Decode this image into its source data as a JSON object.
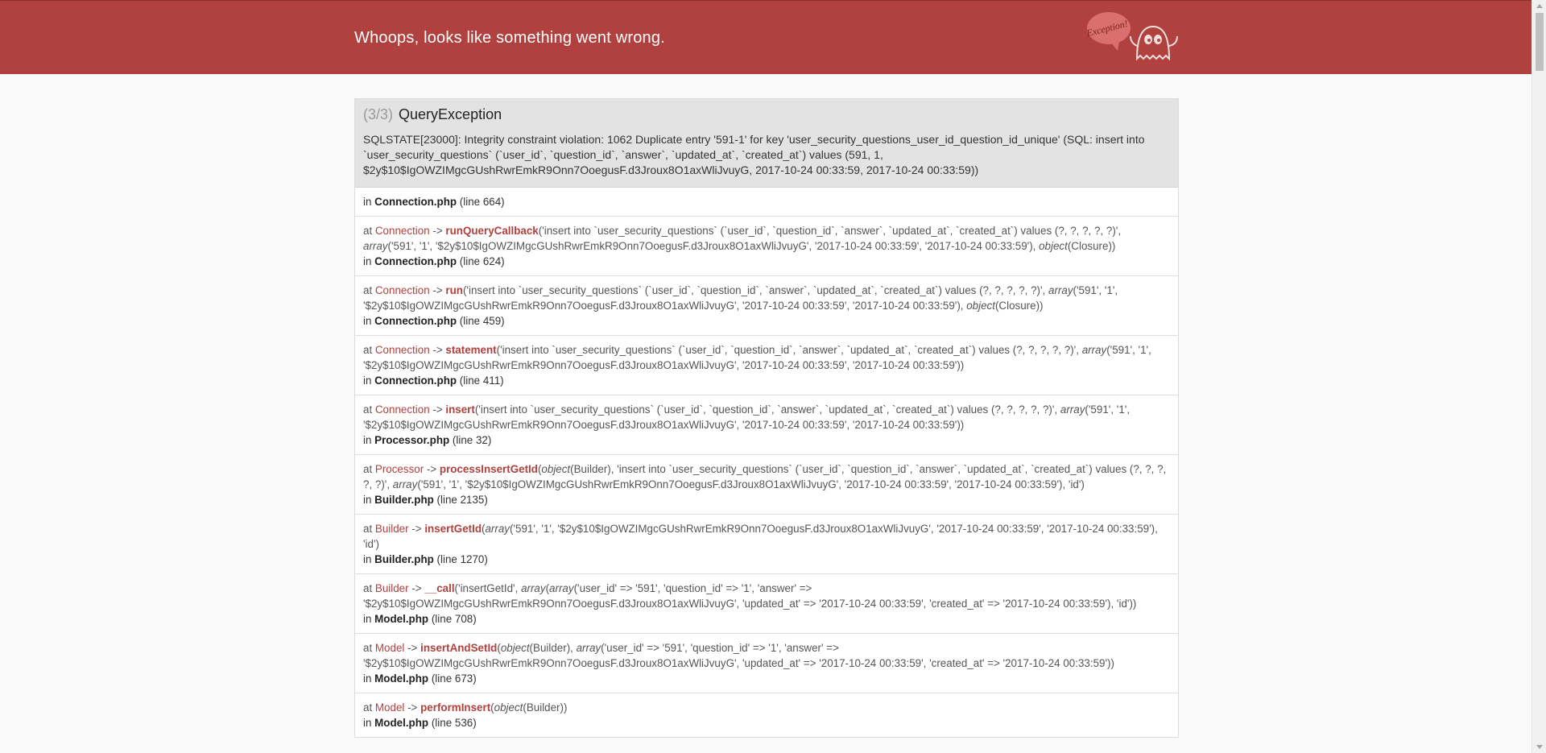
{
  "header": {
    "title": "Whoops, looks like something went wrong.",
    "logo_text": "Exception!",
    "logo_icon": "ghost-icon",
    "bg_color": "#b0413e"
  },
  "exception": {
    "count": "(3/3)",
    "name": "QueryException",
    "message": "SQLSTATE[23000]: Integrity constraint violation: 1062 Duplicate entry '591-1' for key 'user_security_questions_user_id_question_id_unique' (SQL: insert into `user_security_questions` (`user_id`, `question_id`, `answer`, `updated_at`, `created_at`) values (591, 1, $2y$10$IgOWZIMgcGUshRwrEmkR9Onn7OoegusF.d3Jroux8O1axWliJvuyG, 2017-10-24 00:33:59, 2017-10-24 00:33:59))"
  },
  "trace": [
    {
      "in_prefix": "in ",
      "file": "Connection.php",
      "line": "(line 664)"
    },
    {
      "at": "at ",
      "class": "Connection",
      "arrow": " -> ",
      "method": "runQueryCallback",
      "args_html": "('insert into `user_security_questions` (`user_id`, `question_id`, `answer`, `updated_at`, `created_at`) values (?, ?, ?, ?, ?)', <i>array</i>('591', '1', '$2y$10$IgOWZIMgcGUshRwrEmkR9Onn7OoegusF.d3Jroux8O1axWliJvuyG', '2017-10-24 00:33:59', '2017-10-24 00:33:59'), <i>object</i>(Closure))",
      "in_prefix": "in ",
      "file": "Connection.php",
      "line": "(line 624)"
    },
    {
      "at": "at ",
      "class": "Connection",
      "arrow": " -> ",
      "method": "run",
      "args_html": "('insert into `user_security_questions` (`user_id`, `question_id`, `answer`, `updated_at`, `created_at`) values (?, ?, ?, ?, ?)', <i>array</i>('591', '1', '$2y$10$IgOWZIMgcGUshRwrEmkR9Onn7OoegusF.d3Jroux8O1axWliJvuyG', '2017-10-24 00:33:59', '2017-10-24 00:33:59'), <i>object</i>(Closure))",
      "in_prefix": "in ",
      "file": "Connection.php",
      "line": "(line 459)"
    },
    {
      "at": "at ",
      "class": "Connection",
      "arrow": " -> ",
      "method": "statement",
      "args_html": "('insert into `user_security_questions` (`user_id`, `question_id`, `answer`, `updated_at`, `created_at`) values (?, ?, ?, ?, ?)', <i>array</i>('591', '1', '$2y$10$IgOWZIMgcGUshRwrEmkR9Onn7OoegusF.d3Jroux8O1axWliJvuyG', '2017-10-24 00:33:59', '2017-10-24 00:33:59'))",
      "in_prefix": "in ",
      "file": "Connection.php",
      "line": "(line 411)"
    },
    {
      "at": "at ",
      "class": "Connection",
      "arrow": " -> ",
      "method": "insert",
      "args_html": "('insert into `user_security_questions` (`user_id`, `question_id`, `answer`, `updated_at`, `created_at`) values (?, ?, ?, ?, ?)', <i>array</i>('591', '1', '$2y$10$IgOWZIMgcGUshRwrEmkR9Onn7OoegusF.d3Jroux8O1axWliJvuyG', '2017-10-24 00:33:59', '2017-10-24 00:33:59'))",
      "in_prefix": "in ",
      "file": "Processor.php",
      "line": "(line 32)"
    },
    {
      "at": "at ",
      "class": "Processor",
      "arrow": " -> ",
      "method": "processInsertGetId",
      "args_html": "(<i>object</i>(Builder), 'insert into `user_security_questions` (`user_id`, `question_id`, `answer`, `updated_at`, `created_at`) values (?, ?, ?, ?, ?)', <i>array</i>('591', '1', '$2y$10$IgOWZIMgcGUshRwrEmkR9Onn7OoegusF.d3Jroux8O1axWliJvuyG', '2017-10-24 00:33:59', '2017-10-24 00:33:59'), 'id')",
      "in_prefix": "in ",
      "file": "Builder.php",
      "line": "(line 2135)"
    },
    {
      "at": "at ",
      "class": "Builder",
      "arrow": " -> ",
      "method": "insertGetId",
      "args_html": "(<i>array</i>('591', '1', '$2y$10$IgOWZIMgcGUshRwrEmkR9Onn7OoegusF.d3Jroux8O1axWliJvuyG', '2017-10-24 00:33:59', '2017-10-24 00:33:59'), 'id')",
      "in_prefix": "in ",
      "file": "Builder.php",
      "line": "(line 1270)"
    },
    {
      "at": "at ",
      "class": "Builder",
      "arrow": " -> ",
      "method": "__call",
      "args_html": "('insertGetId', <i>array</i>(<i>array</i>('user_id' =&gt; '591', 'question_id' =&gt; '1', 'answer' =&gt; '$2y$10$IgOWZIMgcGUshRwrEmkR9Onn7OoegusF.d3Jroux8O1axWliJvuyG', 'updated_at' =&gt; '2017-10-24 00:33:59', 'created_at' =&gt; '2017-10-24 00:33:59'), 'id'))",
      "in_prefix": "in ",
      "file": "Model.php",
      "line": "(line 708)"
    },
    {
      "at": "at ",
      "class": "Model",
      "arrow": " -> ",
      "method": "insertAndSetId",
      "args_html": "(<i>object</i>(Builder), <i>array</i>('user_id' =&gt; '591', 'question_id' =&gt; '1', 'answer' =&gt; '$2y$10$IgOWZIMgcGUshRwrEmkR9Onn7OoegusF.d3Jroux8O1axWliJvuyG', 'updated_at' =&gt; '2017-10-24 00:33:59', 'created_at' =&gt; '2017-10-24 00:33:59'))",
      "in_prefix": "in ",
      "file": "Model.php",
      "line": "(line 673)"
    },
    {
      "at": "at ",
      "class": "Model",
      "arrow": " -> ",
      "method": "performInsert",
      "args_html": "(<i>object</i>(Builder))",
      "in_prefix": "in ",
      "file": "Model.php",
      "line": "(line 536)"
    }
  ]
}
